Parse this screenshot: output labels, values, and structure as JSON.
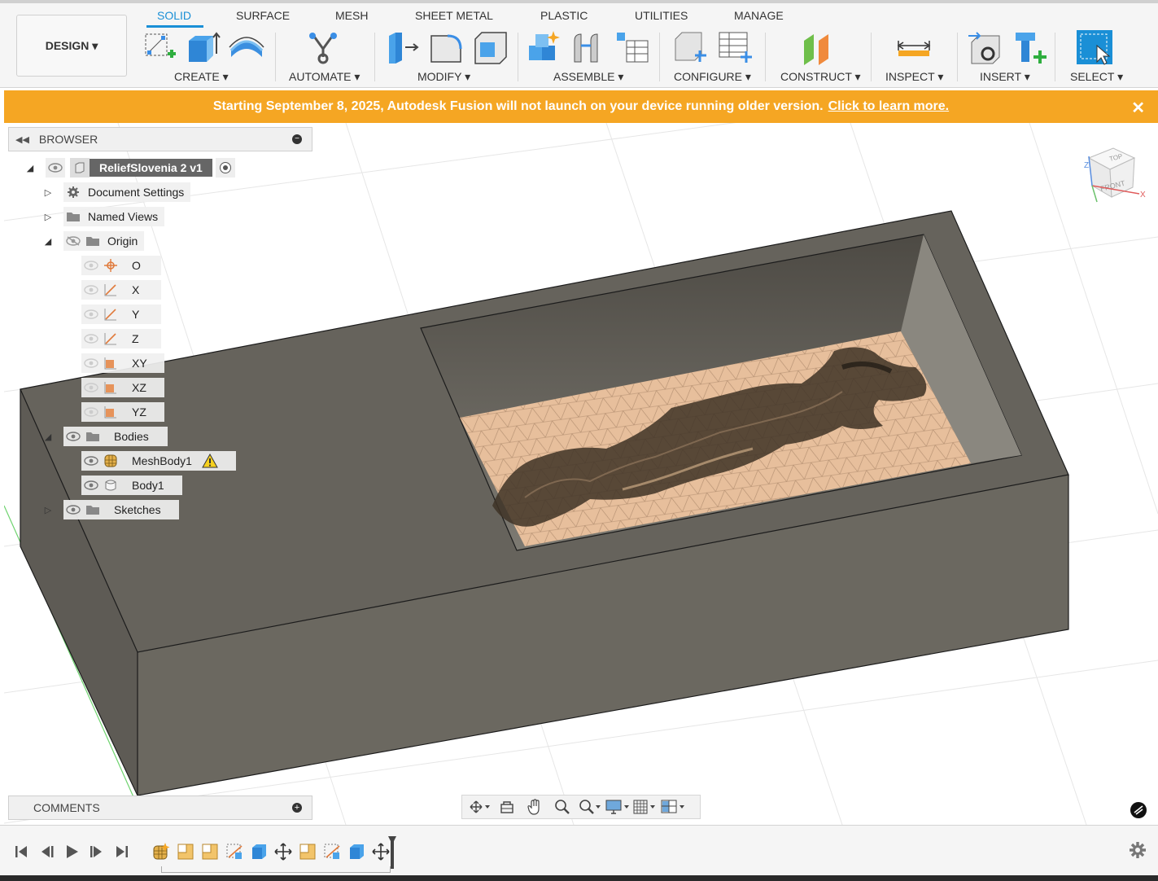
{
  "toolbar": {
    "design_label": "DESIGN ▾",
    "tabs": [
      {
        "label": "SOLID",
        "active": true
      },
      {
        "label": "SURFACE",
        "active": false
      },
      {
        "label": "MESH",
        "active": false
      },
      {
        "label": "SHEET METAL",
        "active": false
      },
      {
        "label": "PLASTIC",
        "active": false
      },
      {
        "label": "UTILITIES",
        "active": false
      },
      {
        "label": "MANAGE",
        "active": false
      }
    ],
    "groups": [
      {
        "label": "CREATE ▾",
        "icons": [
          "new-sketch-icon",
          "extrude-icon",
          "revolve-icon"
        ]
      },
      {
        "label": "AUTOMATE ▾",
        "icons": [
          "automate-icon"
        ]
      },
      {
        "label": "MODIFY ▾",
        "icons": [
          "press-pull-icon",
          "fillet-icon",
          "shell-icon"
        ]
      },
      {
        "label": "ASSEMBLE ▾",
        "icons": [
          "new-component-icon",
          "joint-icon",
          "bom-table-icon"
        ]
      },
      {
        "label": "CONFIGURE ▾",
        "icons": [
          "configure-icon",
          "configuration-table-icon"
        ]
      },
      {
        "label": "CONSTRUCT ▾",
        "icons": [
          "offset-plane-icon"
        ]
      },
      {
        "label": "INSPECT ▾",
        "icons": [
          "measure-icon"
        ]
      },
      {
        "label": "INSERT ▾",
        "icons": [
          "insert-derive-icon",
          "insert-mcmaster-icon"
        ]
      },
      {
        "label": "SELECT ▾",
        "icons": [
          "select-icon"
        ]
      }
    ]
  },
  "banner": {
    "message": "Starting September 8, 2025, Autodesk Fusion will not launch on your device running older version.",
    "link_text": "Click to learn more.",
    "close": "✕",
    "color": "#f5a623"
  },
  "browser": {
    "title": "BROWSER",
    "root": {
      "label": "ReliefSlovenia 2 v1"
    },
    "items": {
      "document_settings": "Document Settings",
      "named_views": "Named Views",
      "origin": "Origin",
      "origin_children": [
        "O",
        "X",
        "Y",
        "Z",
        "XY",
        "XZ",
        "YZ"
      ],
      "bodies": "Bodies",
      "mesh_body": "MeshBody1",
      "body": "Body1",
      "sketches": "Sketches"
    }
  },
  "viewcube": {
    "top": "TOP",
    "front": "FRONT",
    "x_axis": "X",
    "z_axis": "Z"
  },
  "comments": {
    "title": "COMMENTS"
  },
  "navbar": {
    "icons": [
      "orbit-icon",
      "look-at-icon",
      "pan-icon",
      "zoom-icon",
      "zoom-window-icon",
      "display-settings-icon",
      "grid-settings-icon",
      "viewports-icon"
    ]
  },
  "timeline": {
    "playback": [
      "first-step-icon",
      "previous-step-icon",
      "play-icon",
      "next-step-icon",
      "last-step-icon"
    ],
    "features": [
      "mesh-feature-icon",
      "sketch-feature-icon",
      "sketch-feature-icon",
      "plane-feature-icon",
      "extrude-feature-icon",
      "move-feature-icon",
      "sketch-feature-icon",
      "plane-feature-icon",
      "extrude-feature-icon",
      "move-feature-icon"
    ]
  },
  "colors": {
    "accent": "#1a8fd6",
    "box": "#6b6860",
    "box_top": "#66635c",
    "relief": "#e7bf9c"
  }
}
